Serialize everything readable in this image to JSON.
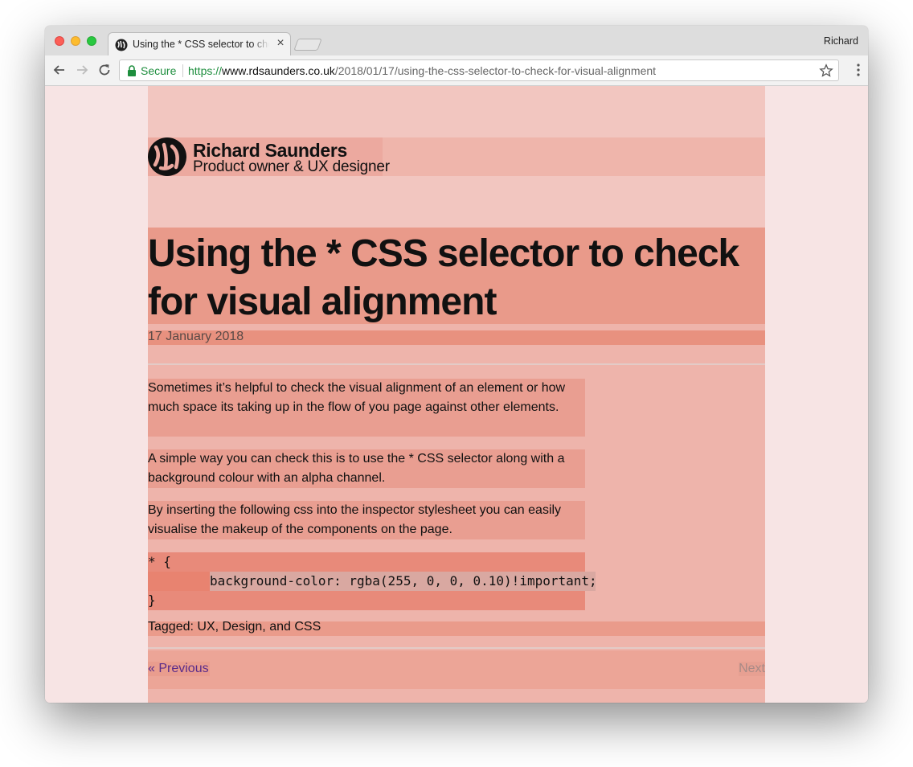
{
  "browser": {
    "tab": {
      "title": "Using the * CSS selector to check for visual alignment",
      "close_glyph": "×",
      "favicon": "site-logo-icon"
    },
    "profile_name": "Richard",
    "nav": {
      "back_icon": "arrow-left-icon",
      "forward_icon": "arrow-right-icon",
      "reload_icon": "reload-icon"
    },
    "address_bar": {
      "secure_label": "Secure",
      "scheme": "https://",
      "host": "www.rdsaunders.co.uk",
      "path": "/2018/01/17/using-the-css-selector-to-check-for-visual-alignment",
      "bookmark_icon": "star-icon",
      "menu_icon": "kebab-menu-icon"
    }
  },
  "site": {
    "name": "Richard Saunders",
    "tagline": "Product owner & UX designer"
  },
  "post": {
    "title": "Using the * CSS selector to check for visual alignment",
    "date": "17 January 2018",
    "paragraphs": [
      "Sometimes it’s helpful to check the visual alignment of an element or how much space its taking up in the flow of you page against other elements.",
      "A simple way you can check this is to use the * CSS selector along with a background colour with an alpha channel.",
      "By inserting the following css into the inspector stylesheet you can easily visualise the makeup of the components on the page."
    ],
    "code": {
      "line1": "* {",
      "line2": "background-color: rgba(255, 0, 0, 0.10)!important;",
      "line3": "}"
    },
    "tags_label": "Tagged: UX, Design, and CSS",
    "pager": {
      "previous": "« Previous",
      "next": "Next"
    }
  },
  "colors": {
    "page_background": "#f7e4e4",
    "accent_secure": "#1e8e3e",
    "link": "#5a2b8a"
  }
}
